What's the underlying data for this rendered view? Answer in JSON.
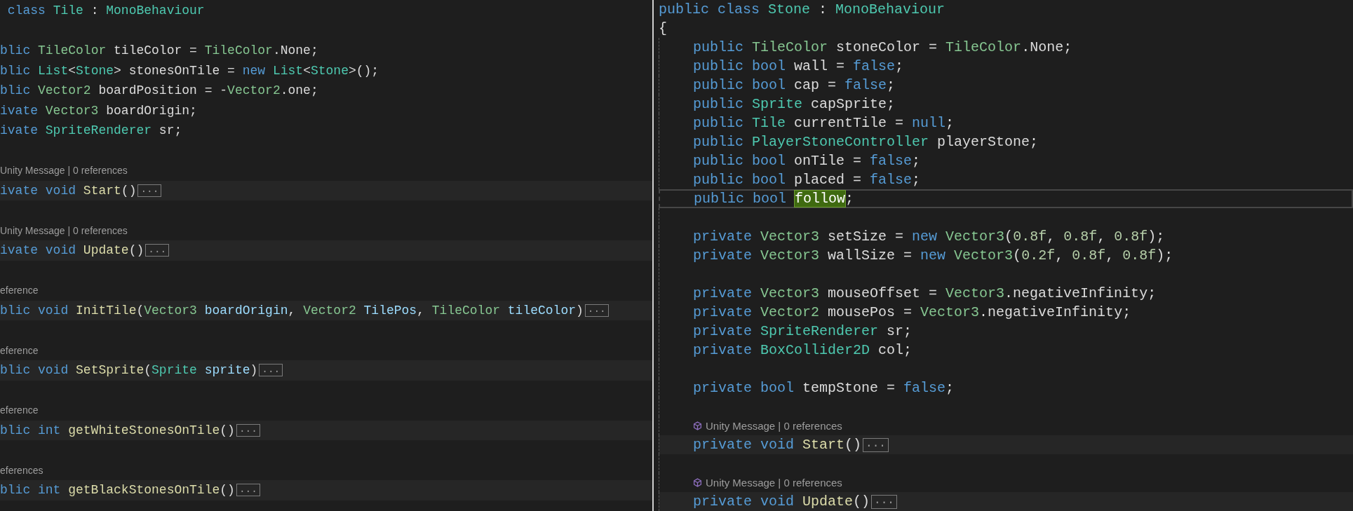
{
  "panes": [
    {
      "lines": [
        {
          "kind": "code",
          "current": false,
          "tokens": [
            {
              "kind": "kw",
              "text": " class "
            },
            {
              "kind": "ty",
              "text": "Tile"
            },
            {
              "kind": "pl",
              "text": " : "
            },
            {
              "kind": "ty",
              "text": "MonoBehaviour"
            }
          ]
        },
        {
          "kind": "blank"
        },
        {
          "kind": "code",
          "current": false,
          "tokens": [
            {
              "kind": "kw",
              "text": "blic "
            },
            {
              "kind": "st",
              "text": "TileColor"
            },
            {
              "kind": "pl",
              "text": " tileColor = "
            },
            {
              "kind": "st",
              "text": "TileColor"
            },
            {
              "kind": "pl",
              "text": ".None;"
            }
          ]
        },
        {
          "kind": "code",
          "current": false,
          "tokens": [
            {
              "kind": "kw",
              "text": "blic "
            },
            {
              "kind": "ty",
              "text": "List"
            },
            {
              "kind": "pl",
              "text": "<"
            },
            {
              "kind": "ty",
              "text": "Stone"
            },
            {
              "kind": "pl",
              "text": "> stonesOnTile = "
            },
            {
              "kind": "kw",
              "text": "new "
            },
            {
              "kind": "ty",
              "text": "List"
            },
            {
              "kind": "pl",
              "text": "<"
            },
            {
              "kind": "ty",
              "text": "Stone"
            },
            {
              "kind": "pl",
              "text": ">();"
            }
          ]
        },
        {
          "kind": "code",
          "current": false,
          "tokens": [
            {
              "kind": "kw",
              "text": "blic "
            },
            {
              "kind": "st",
              "text": "Vector2"
            },
            {
              "kind": "pl",
              "text": " boardPosition = -"
            },
            {
              "kind": "st",
              "text": "Vector2"
            },
            {
              "kind": "pl",
              "text": ".one;"
            }
          ]
        },
        {
          "kind": "code",
          "current": false,
          "tokens": [
            {
              "kind": "kw",
              "text": "ivate "
            },
            {
              "kind": "st",
              "text": "Vector3"
            },
            {
              "kind": "pl",
              "text": " boardOrigin;"
            }
          ]
        },
        {
          "kind": "code",
          "current": false,
          "tokens": [
            {
              "kind": "kw",
              "text": "ivate "
            },
            {
              "kind": "ty",
              "text": "SpriteRenderer"
            },
            {
              "kind": "pl",
              "text": " sr;"
            }
          ]
        },
        {
          "kind": "blank"
        },
        {
          "kind": "lens",
          "icon": false,
          "text": "Unity Message | 0 references"
        },
        {
          "kind": "code",
          "current": false,
          "fold": "...",
          "tokens": [
            {
              "kind": "kw",
              "text": "ivate void "
            },
            {
              "kind": "fn",
              "text": "Start"
            },
            {
              "kind": "pl",
              "text": "()"
            }
          ]
        },
        {
          "kind": "blank"
        },
        {
          "kind": "lens",
          "icon": false,
          "text": "Unity Message | 0 references"
        },
        {
          "kind": "code",
          "current": false,
          "fold": "...",
          "tokens": [
            {
              "kind": "kw",
              "text": "ivate void "
            },
            {
              "kind": "fn",
              "text": "Update"
            },
            {
              "kind": "pl",
              "text": "()"
            }
          ]
        },
        {
          "kind": "blank"
        },
        {
          "kind": "lens",
          "icon": false,
          "text": "eference"
        },
        {
          "kind": "code",
          "current": false,
          "fold": "...",
          "tokens": [
            {
              "kind": "kw",
              "text": "blic void "
            },
            {
              "kind": "fn",
              "text": "InitTile"
            },
            {
              "kind": "pl",
              "text": "("
            },
            {
              "kind": "st",
              "text": "Vector3"
            },
            {
              "kind": "pa",
              "text": " boardOrigin"
            },
            {
              "kind": "pl",
              "text": ", "
            },
            {
              "kind": "st",
              "text": "Vector2"
            },
            {
              "kind": "pa",
              "text": " TilePos"
            },
            {
              "kind": "pl",
              "text": ", "
            },
            {
              "kind": "st",
              "text": "TileColor"
            },
            {
              "kind": "pa",
              "text": " tileColor"
            },
            {
              "kind": "pl",
              "text": ")"
            }
          ]
        },
        {
          "kind": "blank"
        },
        {
          "kind": "lens",
          "icon": false,
          "text": "eference"
        },
        {
          "kind": "code",
          "current": false,
          "fold": "...",
          "tokens": [
            {
              "kind": "kw",
              "text": "blic void "
            },
            {
              "kind": "fn",
              "text": "SetSprite"
            },
            {
              "kind": "pl",
              "text": "("
            },
            {
              "kind": "ty",
              "text": "Sprite"
            },
            {
              "kind": "pa",
              "text": " sprite"
            },
            {
              "kind": "pl",
              "text": ")"
            }
          ]
        },
        {
          "kind": "blank"
        },
        {
          "kind": "lens",
          "icon": false,
          "text": "eference"
        },
        {
          "kind": "code",
          "current": false,
          "fold": "...",
          "tokens": [
            {
              "kind": "kw",
              "text": "blic int "
            },
            {
              "kind": "fn",
              "text": "getWhiteStonesOnTile"
            },
            {
              "kind": "pl",
              "text": "()"
            }
          ]
        },
        {
          "kind": "blank"
        },
        {
          "kind": "lens",
          "icon": false,
          "text": "eferences"
        },
        {
          "kind": "code",
          "current": false,
          "fold": "...",
          "tokens": [
            {
              "kind": "kw",
              "text": "blic int "
            },
            {
              "kind": "fn",
              "text": "getBlackStonesOnTile"
            },
            {
              "kind": "pl",
              "text": "()"
            }
          ]
        }
      ]
    },
    {
      "lines": [
        {
          "kind": "code",
          "current": false,
          "tokens": [
            {
              "kind": "kw",
              "text": "public class "
            },
            {
              "kind": "ty",
              "text": "Stone"
            },
            {
              "kind": "pl",
              "text": " : "
            },
            {
              "kind": "ty",
              "text": "MonoBehaviour"
            }
          ]
        },
        {
          "kind": "code",
          "current": false,
          "tokens": [
            {
              "kind": "pl",
              "text": "{"
            }
          ]
        },
        {
          "kind": "code",
          "current": false,
          "tokens": [
            {
              "kind": "kw",
              "text": "    public "
            },
            {
              "kind": "st",
              "text": "TileColor"
            },
            {
              "kind": "pl",
              "text": " stoneColor = "
            },
            {
              "kind": "st",
              "text": "TileColor"
            },
            {
              "kind": "pl",
              "text": ".None;"
            }
          ]
        },
        {
          "kind": "code",
          "current": false,
          "tokens": [
            {
              "kind": "kw",
              "text": "    public bool "
            },
            {
              "kind": "pl",
              "text": "wall = "
            },
            {
              "kind": "kw",
              "text": "false"
            },
            {
              "kind": "pl",
              "text": ";"
            }
          ]
        },
        {
          "kind": "code",
          "current": false,
          "tokens": [
            {
              "kind": "kw",
              "text": "    public bool "
            },
            {
              "kind": "pl",
              "text": "cap = "
            },
            {
              "kind": "kw",
              "text": "false"
            },
            {
              "kind": "pl",
              "text": ";"
            }
          ]
        },
        {
          "kind": "code",
          "current": false,
          "tokens": [
            {
              "kind": "kw",
              "text": "    public "
            },
            {
              "kind": "ty",
              "text": "Sprite"
            },
            {
              "kind": "pl",
              "text": " capSprite;"
            }
          ]
        },
        {
          "kind": "code",
          "current": false,
          "tokens": [
            {
              "kind": "kw",
              "text": "    public "
            },
            {
              "kind": "ty",
              "text": "Tile"
            },
            {
              "kind": "pl",
              "text": " currentTile = "
            },
            {
              "kind": "kw",
              "text": "null"
            },
            {
              "kind": "pl",
              "text": ";"
            }
          ]
        },
        {
          "kind": "code",
          "current": false,
          "tokens": [
            {
              "kind": "kw",
              "text": "    public "
            },
            {
              "kind": "ty",
              "text": "PlayerStoneController"
            },
            {
              "kind": "pl",
              "text": " playerStone;"
            }
          ]
        },
        {
          "kind": "code",
          "current": false,
          "tokens": [
            {
              "kind": "kw",
              "text": "    public bool "
            },
            {
              "kind": "pl",
              "text": "onTile = "
            },
            {
              "kind": "kw",
              "text": "false"
            },
            {
              "kind": "pl",
              "text": ";"
            }
          ]
        },
        {
          "kind": "code",
          "current": false,
          "tokens": [
            {
              "kind": "kw",
              "text": "    public bool "
            },
            {
              "kind": "pl",
              "text": "placed = "
            },
            {
              "kind": "kw",
              "text": "false"
            },
            {
              "kind": "pl",
              "text": ";"
            }
          ]
        },
        {
          "kind": "code",
          "current": true,
          "tokens": [
            {
              "kind": "kw",
              "text": "    public bool "
            },
            {
              "kind": "hl",
              "text": "follow"
            },
            {
              "kind": "pl",
              "text": ";"
            }
          ]
        },
        {
          "kind": "blank"
        },
        {
          "kind": "code",
          "current": false,
          "tokens": [
            {
              "kind": "kw",
              "text": "    private "
            },
            {
              "kind": "st",
              "text": "Vector3"
            },
            {
              "kind": "pl",
              "text": " setSize = "
            },
            {
              "kind": "kw",
              "text": "new "
            },
            {
              "kind": "st",
              "text": "Vector3"
            },
            {
              "kind": "pl",
              "text": "("
            },
            {
              "kind": "nm",
              "text": "0.8f"
            },
            {
              "kind": "pl",
              "text": ", "
            },
            {
              "kind": "nm",
              "text": "0.8f"
            },
            {
              "kind": "pl",
              "text": ", "
            },
            {
              "kind": "nm",
              "text": "0.8f"
            },
            {
              "kind": "pl",
              "text": ");"
            }
          ]
        },
        {
          "kind": "code",
          "current": false,
          "tokens": [
            {
              "kind": "kw",
              "text": "    private "
            },
            {
              "kind": "st",
              "text": "Vector3"
            },
            {
              "kind": "pl",
              "text": " wallSize = "
            },
            {
              "kind": "kw",
              "text": "new "
            },
            {
              "kind": "st",
              "text": "Vector3"
            },
            {
              "kind": "pl",
              "text": "("
            },
            {
              "kind": "nm",
              "text": "0.2f"
            },
            {
              "kind": "pl",
              "text": ", "
            },
            {
              "kind": "nm",
              "text": "0.8f"
            },
            {
              "kind": "pl",
              "text": ", "
            },
            {
              "kind": "nm",
              "text": "0.8f"
            },
            {
              "kind": "pl",
              "text": ");"
            }
          ]
        },
        {
          "kind": "blank"
        },
        {
          "kind": "code",
          "current": false,
          "tokens": [
            {
              "kind": "kw",
              "text": "    private "
            },
            {
              "kind": "st",
              "text": "Vector3"
            },
            {
              "kind": "pl",
              "text": " mouseOffset = "
            },
            {
              "kind": "st",
              "text": "Vector3"
            },
            {
              "kind": "pl",
              "text": ".negativeInfinity;"
            }
          ]
        },
        {
          "kind": "code",
          "current": false,
          "tokens": [
            {
              "kind": "kw",
              "text": "    private "
            },
            {
              "kind": "st",
              "text": "Vector2"
            },
            {
              "kind": "pl",
              "text": " mousePos = "
            },
            {
              "kind": "st",
              "text": "Vector3"
            },
            {
              "kind": "pl",
              "text": ".negativeInfinity;"
            }
          ]
        },
        {
          "kind": "code",
          "current": false,
          "tokens": [
            {
              "kind": "kw",
              "text": "    private "
            },
            {
              "kind": "ty",
              "text": "SpriteRenderer"
            },
            {
              "kind": "pl",
              "text": " sr;"
            }
          ]
        },
        {
          "kind": "code",
          "current": false,
          "tokens": [
            {
              "kind": "kw",
              "text": "    private "
            },
            {
              "kind": "ty",
              "text": "BoxCollider2D"
            },
            {
              "kind": "pl",
              "text": " col;"
            }
          ]
        },
        {
          "kind": "blank"
        },
        {
          "kind": "code",
          "current": false,
          "tokens": [
            {
              "kind": "kw",
              "text": "    private bool "
            },
            {
              "kind": "pl",
              "text": "tempStone = "
            },
            {
              "kind": "kw",
              "text": "false"
            },
            {
              "kind": "pl",
              "text": ";"
            }
          ]
        },
        {
          "kind": "blank"
        },
        {
          "kind": "lens",
          "icon": true,
          "text": "Unity Message | 0 references"
        },
        {
          "kind": "code",
          "current": false,
          "fold": "...",
          "tokens": [
            {
              "kind": "kw",
              "text": "    private void "
            },
            {
              "kind": "fn",
              "text": "Start"
            },
            {
              "kind": "pl",
              "text": "()"
            }
          ]
        },
        {
          "kind": "blank"
        },
        {
          "kind": "lens",
          "icon": true,
          "text": "Unity Message | 0 references"
        },
        {
          "kind": "code",
          "current": false,
          "fold": "...",
          "tokens": [
            {
              "kind": "kw",
              "text": "    private void "
            },
            {
              "kind": "fn",
              "text": "Update"
            },
            {
              "kind": "pl",
              "text": "()"
            }
          ]
        }
      ]
    }
  ]
}
